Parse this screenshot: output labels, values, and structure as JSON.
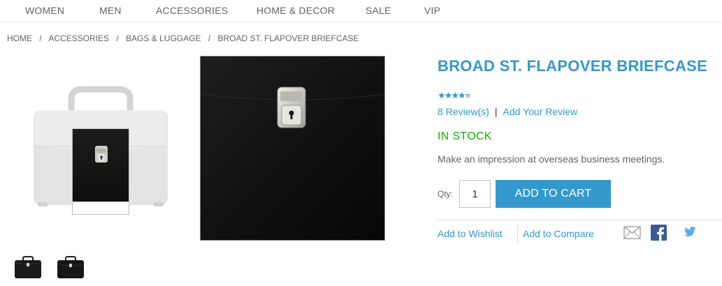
{
  "nav": {
    "items": [
      "WOMEN",
      "MEN",
      "ACCESSORIES",
      "HOME & DECOR",
      "SALE",
      "VIP"
    ]
  },
  "breadcrumb": {
    "items": [
      "HOME",
      "ACCESSORIES",
      "BAGS & LUGGAGE",
      "BROAD ST. FLAPOVER BRIEFCASE"
    ],
    "separator": "/"
  },
  "product": {
    "name": "BROAD ST. FLAPOVER BRIEFCASE",
    "rating_stars": 4.5,
    "rating_max": 5,
    "reviews_link": "8 Review(s)",
    "review_separator": "|",
    "add_review_link": "Add Your Review",
    "stock_status": "IN STOCK",
    "short_description": "Make an impression at overseas business meetings.",
    "qty_label": "Qty:",
    "qty_value": "1",
    "add_to_cart_label": "ADD TO CART",
    "add_to_wishlist": "Add to Wishlist",
    "add_to_compare": "Add to Compare"
  },
  "share": {
    "icons": [
      "email-icon",
      "facebook-icon",
      "twitter-icon"
    ]
  },
  "thumbnails": {
    "count": 2
  },
  "colors": {
    "accent": "#3399cc",
    "in_stock": "#11b400",
    "text_muted": "#636363"
  }
}
